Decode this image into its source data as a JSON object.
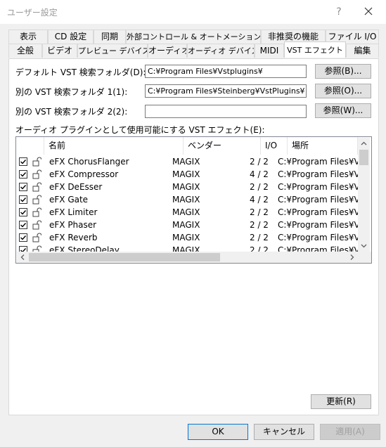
{
  "window": {
    "title": "ユーザー設定",
    "help": "?"
  },
  "tabs_row1": [
    "表示",
    "CD 設定",
    "同期",
    "外部コントロール & オートメーション",
    "非推奨の機能",
    "ファイル I/O"
  ],
  "tabs_row2": [
    "全般",
    "ビデオ",
    "プレビュー デバイス",
    "オーディオ",
    "オーディオ デバイス",
    "MIDI",
    "VST エフェクト",
    "編集"
  ],
  "folders": {
    "default_label": "デフォルト VST 検索フォルダ(D):",
    "default_value": "C:¥Program Files¥Vstplugins¥",
    "alt1_label": "別の VST 検索フォルダ 1(1):",
    "alt1_value": "C:¥Program Files¥Steinberg¥VstPlugins¥",
    "alt2_label": "別の VST 検索フォルダ 2(2):",
    "alt2_value": "",
    "browse_b": "参照(B)...",
    "browse_o": "参照(O)...",
    "browse_w": "参照(W)..."
  },
  "list": {
    "caption": "オーディオ プラグインとして使用可能にする VST エフェクト(E):",
    "headers": {
      "name": "名前",
      "vendor": "ベンダー",
      "io": "I/O",
      "location": "場所"
    },
    "rows": [
      {
        "name": "eFX ChorusFlanger",
        "vendor": "MAGIX",
        "io": "2 / 2",
        "location": "C:¥Program Files¥VEGAS",
        "checked": true
      },
      {
        "name": "eFX Compressor",
        "vendor": "MAGIX",
        "io": "4 / 2",
        "location": "C:¥Program Files¥VEGAS",
        "checked": true
      },
      {
        "name": "eFX DeEsser",
        "vendor": "MAGIX",
        "io": "2 / 2",
        "location": "C:¥Program Files¥VEGAS",
        "checked": true
      },
      {
        "name": "eFX Gate",
        "vendor": "MAGIX",
        "io": "4 / 2",
        "location": "C:¥Program Files¥VEGAS",
        "checked": true
      },
      {
        "name": "eFX Limiter",
        "vendor": "MAGIX",
        "io": "2 / 2",
        "location": "C:¥Program Files¥VEGAS",
        "checked": true
      },
      {
        "name": "eFX Phaser",
        "vendor": "MAGIX",
        "io": "2 / 2",
        "location": "C:¥Program Files¥VEGAS",
        "checked": true
      },
      {
        "name": "eFX Reverb",
        "vendor": "MAGIX",
        "io": "2 / 2",
        "location": "C:¥Program Files¥VEGAS",
        "checked": true
      },
      {
        "name": "eFX StereoDelay",
        "vendor": "MAGIX",
        "io": "2 / 2",
        "location": "C:¥Program Files¥VEGAS",
        "checked": true
      }
    ]
  },
  "buttons": {
    "refresh": "更新(R)",
    "ok": "OK",
    "cancel": "キャンセル",
    "apply": "適用(A)"
  }
}
